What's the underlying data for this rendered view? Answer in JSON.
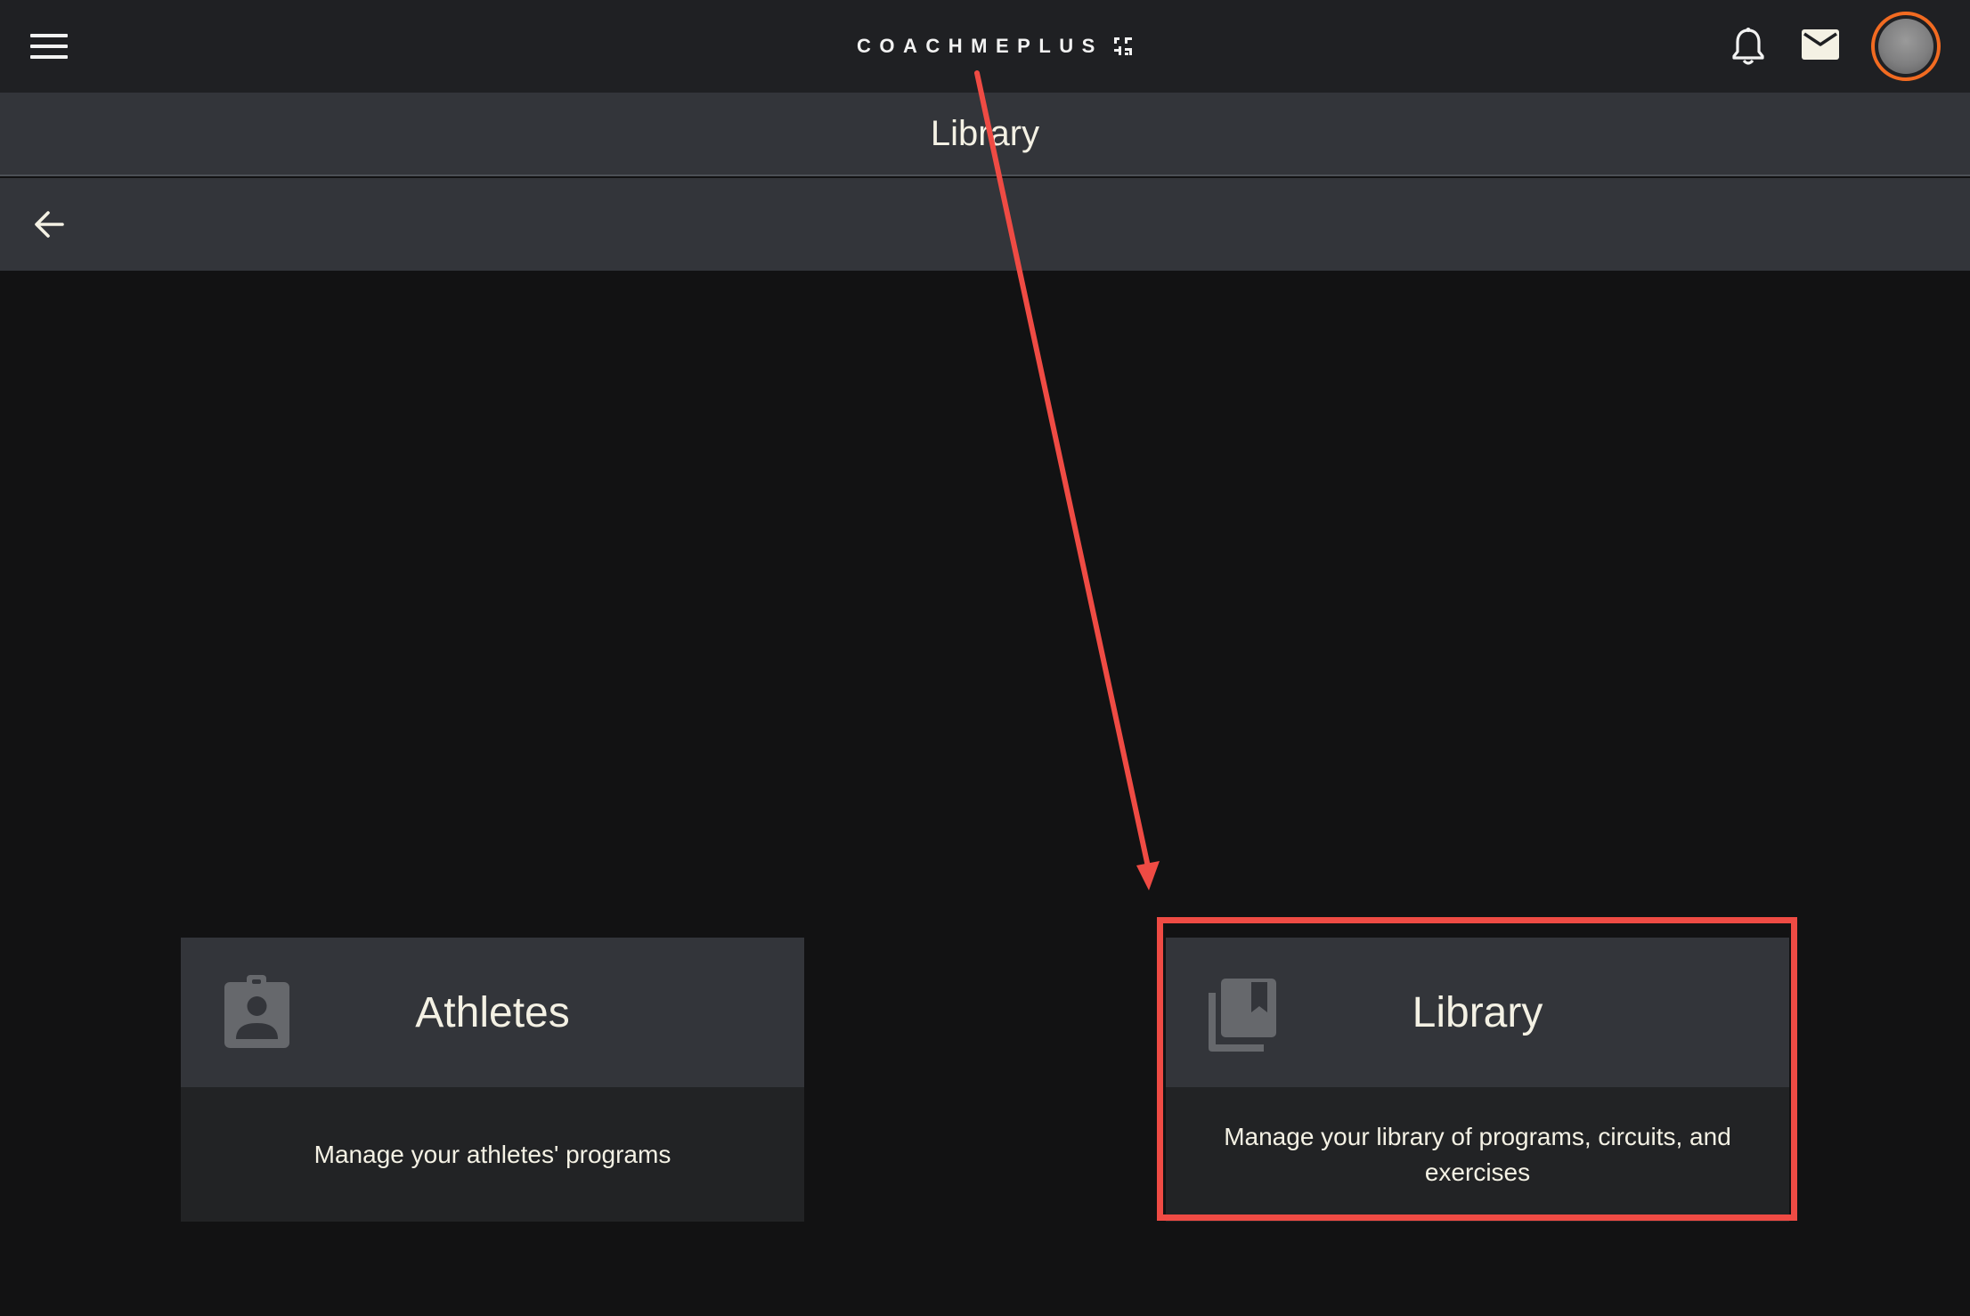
{
  "app": {
    "brand": "COACHMEPLUS"
  },
  "header": {
    "title": "Library"
  },
  "cards": [
    {
      "title": "Athletes",
      "description": "Manage your athletes' programs",
      "icon": "clipboard-account-icon"
    },
    {
      "title": "Library",
      "description": "Manage your library of programs, circuits, and exercises",
      "icon": "library-books-icon"
    }
  ],
  "colors": {
    "topbar": "#1f2023",
    "titlebar": "#33353a",
    "background": "#121213",
    "card_head": "#33353a",
    "card_body": "#222325",
    "text": "#f4f1e4",
    "avatar_ring": "#f26b21",
    "annotation": "#ef4b44"
  },
  "annotation": {
    "highlighted_card": "Library"
  }
}
